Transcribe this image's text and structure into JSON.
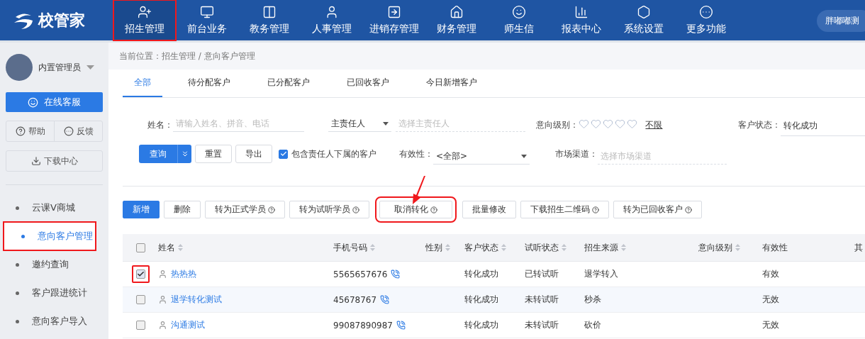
{
  "logo": {
    "text": "校管家"
  },
  "nav": [
    {
      "label": "招生管理",
      "selected": true,
      "marked": true
    },
    {
      "label": "前台业务",
      "selected": false,
      "marked": false
    },
    {
      "label": "教务管理",
      "selected": false,
      "marked": false
    },
    {
      "label": "人事管理",
      "selected": false,
      "marked": false
    },
    {
      "label": "进销存管理",
      "selected": false,
      "marked": false
    },
    {
      "label": "财务管理",
      "selected": false,
      "marked": false
    },
    {
      "label": "师生信",
      "selected": false,
      "marked": false
    },
    {
      "label": "报表中心",
      "selected": false,
      "marked": false
    },
    {
      "label": "系统设置",
      "selected": false,
      "marked": false
    },
    {
      "label": "更多功能",
      "selected": false,
      "marked": false
    }
  ],
  "user_pill": "胖嘟嘟测",
  "sidebar": {
    "user": "内置管理员",
    "service": "在线客服",
    "help": "帮助",
    "feedback": "反馈",
    "download": "下载中心",
    "items": [
      {
        "label": "云课V商城",
        "selected": false,
        "marked": false
      },
      {
        "label": "意向客户管理",
        "selected": true,
        "marked": true
      },
      {
        "label": "邀约查询",
        "selected": false,
        "marked": false
      },
      {
        "label": "客户跟进统计",
        "selected": false,
        "marked": false
      },
      {
        "label": "意向客户导入",
        "selected": false,
        "marked": false
      }
    ]
  },
  "breadcrumb": "当前位置：招生管理 / 意向客户管理",
  "tabs": [
    {
      "label": "全部",
      "selected": true
    },
    {
      "label": "待分配客户",
      "selected": false
    },
    {
      "label": "已分配客户",
      "selected": false
    },
    {
      "label": "已回收客户",
      "selected": false
    },
    {
      "label": "今日新增客户",
      "selected": false
    }
  ],
  "filters": {
    "name_label": "姓名：",
    "name_placeholder": "请输入姓名、拼音、电话",
    "owner_select": "主责任人",
    "owner_placeholder": "选择主责任人",
    "intent_label": "意向级别：",
    "intent_levels": [
      {
        "selected": false
      },
      {
        "selected": false
      },
      {
        "selected": false
      },
      {
        "selected": false
      },
      {
        "selected": false
      }
    ],
    "unlimited": "不限",
    "status_label": "客户状态：",
    "status_value": "转化成功",
    "query": "查询",
    "reset": "重置",
    "export": "导出",
    "include_sub": {
      "label": "包含责任人下属的客户",
      "checked": true
    },
    "validity_label": "有效性：",
    "validity_value": "<全部>",
    "channel_label": "市场渠道：",
    "channel_placeholder": "选择市场渠道"
  },
  "actions": [
    {
      "label": "新增",
      "kind": "primary",
      "help": false,
      "marked": false
    },
    {
      "label": "删除",
      "kind": "plain",
      "help": false,
      "marked": false
    },
    {
      "label": "转为正式学员",
      "kind": "plain",
      "help": true,
      "marked": false
    },
    {
      "label": "转为试听学员",
      "kind": "plain",
      "help": true,
      "marked": false
    },
    {
      "label": "取消转化",
      "kind": "plain",
      "help": true,
      "marked": true
    },
    {
      "label": "批量修改",
      "kind": "plain",
      "help": false,
      "marked": false
    },
    {
      "label": "下载招生二维码",
      "kind": "plain",
      "help": true,
      "marked": false
    },
    {
      "label": "转为已回收客户",
      "kind": "plain",
      "help": true,
      "marked": false
    }
  ],
  "table": {
    "header_checked": false,
    "columns": [
      {
        "label": "姓名",
        "sortable": true
      },
      {
        "label": "手机号码",
        "sortable": true
      },
      {
        "label": "性别",
        "sortable": true
      },
      {
        "label": "客户状态",
        "sortable": true
      },
      {
        "label": "试听状态",
        "sortable": true
      },
      {
        "label": "招生来源",
        "sortable": true
      },
      {
        "label": "意向级别",
        "sortable": true
      },
      {
        "label": "有效性",
        "sortable": false
      },
      {
        "label": "其"
      }
    ],
    "rows": [
      {
        "checked": true,
        "marked": true,
        "name": "热热热",
        "phone": "5565657676",
        "status": "转化成功",
        "trial": "已转试听",
        "source": "退学转入",
        "validity": "有效"
      },
      {
        "checked": false,
        "marked": false,
        "name": "退学转化测试",
        "phone": "45678767",
        "status": "转化成功",
        "trial": "未转试听",
        "source": "秒杀",
        "validity": "无效"
      },
      {
        "checked": false,
        "marked": false,
        "name": "沟通测试",
        "phone": "99087890987",
        "status": "转化成功",
        "trial": "未转试听",
        "source": "砍价",
        "validity": "无效"
      }
    ]
  }
}
